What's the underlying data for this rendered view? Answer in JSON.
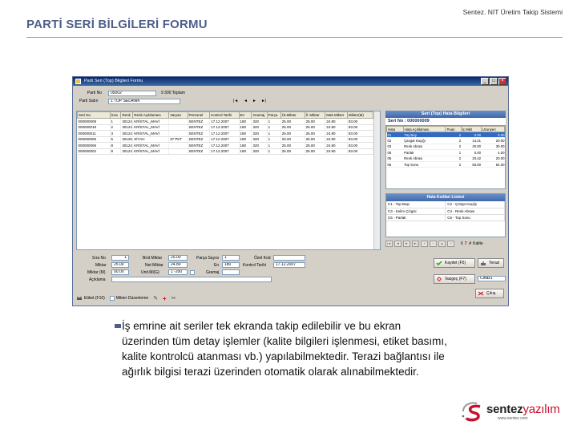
{
  "slide": {
    "title": "PARTİ SERİ BİLGİLERİ FORMU",
    "header_right": "Sentez. NIT Üretim Takip Sistemi",
    "description": "İş emrine ait seriler tek ekranda takip edilebilir ve bu ekran üzerinden tüm detay işlemler (kalite bilgileri işlenmesi, etiket basımı, kalite kontrolcü atanması vb.) yapılabilmektedir. Terazi bağlantısı ile ağırlık bilgisi terazi üzerinden otomatik olarak alınabilmektedir."
  },
  "logo": {
    "brand_a": "sentez",
    "brand_b": "yazılım",
    "url": "www.sentez.com",
    "color_a": "#222222",
    "color_b": "#c8102e"
  },
  "window": {
    "title": "Parti Seri (Top) Bilgileri Formu",
    "minimize": "_",
    "maximize": "□",
    "close": "×"
  },
  "form": {
    "parti_no_label": "Parti No",
    "parti_no_value": "05002",
    "toplam": "9 300 Toplam",
    "parti_sahn_label": "Parti Satırı",
    "parti_sahn_value": "1   TOP SELANİK",
    "nav": [
      "|◄",
      "◄",
      "►",
      "►|"
    ]
  },
  "grid": {
    "columns": [
      "Seri No",
      "Sıra",
      "Renk",
      "Renk Açıklaması",
      "Varyan",
      "Personel",
      "Kontrol Tarihi",
      "En",
      "Gramaj",
      "Parça",
      "Üt.Mikter",
      "İl. Miktar",
      "Mak.Mikter",
      "Mikter(M)"
    ],
    "rows": [
      [
        "000000009",
        "1",
        "301241",
        "KRİSTAL_MAVİ",
        "",
        "SENTEZ",
        "17.12.2007",
        "180",
        "320",
        "1",
        "25.00",
        "25.00",
        "24.80",
        "83.00"
      ],
      [
        "000000018",
        "2",
        "301241",
        "KRİSTAL_MAVİ",
        "",
        "SENTEZ",
        "17.12.2007",
        "180",
        "320",
        "1",
        "25.00",
        "25.00",
        "24.80",
        "83.00"
      ],
      [
        "000000011",
        "3",
        "301241",
        "KRİSTAL_MAVİ",
        "",
        "SENTEZ",
        "17.12.2007",
        "180",
        "320",
        "1",
        "25.00",
        "25.00",
        "24.80",
        "83.00"
      ],
      [
        "000000005",
        "5",
        "301251",
        "SİYAH",
        "37 PKT",
        "SENTEZ",
        "17.12.2007",
        "180",
        "320",
        "1",
        "25.00",
        "25.00",
        "24.80",
        "83.00"
      ],
      [
        "000000006",
        "8",
        "301241",
        "KRİSTAL_MAVİ",
        "",
        "SENTEZ",
        "17.12.2007",
        "180",
        "320",
        "1",
        "25.00",
        "25.00",
        "24.80",
        "83.00"
      ],
      [
        "000000002",
        "9",
        "301241",
        "KRİSTAL_MAVİ",
        "",
        "SENTEZ",
        "17.12.2007",
        "180",
        "320",
        "1",
        "25.00",
        "25.00",
        "24.80",
        "83.00"
      ]
    ]
  },
  "right": {
    "hata_title": "Seri (Top) Hata Bilgileri",
    "seri_no_label": "Seri No :",
    "seri_no_value": "000000009",
    "hata_columns": [
      "Hata",
      "Hata Açıklaması",
      "Puan",
      "İç Mikt",
      "Uzunyeri"
    ],
    "hata_rows": [
      [
        "01",
        "Tüy Boy",
        "2",
        "0.00",
        "0.00"
      ],
      [
        "02",
        "Çavgal Kaçığı",
        "2",
        "14.21",
        "20.00"
      ],
      [
        "03",
        "Renk Abrası",
        "2",
        "20.00",
        "30.00"
      ],
      [
        "05",
        "Parlak",
        "1",
        "0.00",
        "4.00"
      ],
      [
        "05",
        "Renk Abrası",
        "2",
        "20.42",
        "20.00"
      ],
      [
        "06",
        "Top Sonu",
        "2",
        "83.00",
        "84.00"
      ]
    ],
    "hk_title": "Hata Kodları Listesi",
    "hk_rows": [
      [
        "C1 - Top Başı",
        "C2 - Çözgü Kaçığı"
      ],
      [
        "C3 - Kelim Çizgisi",
        "C4 - Renk Abrası"
      ],
      [
        "C5 - Parlak",
        "C6 - Top Sonu"
      ]
    ],
    "nav_count": "6",
    "nav_count2": "7",
    "nav_close": "✗ Kalite"
  },
  "bottom": {
    "sira_no_label": "Sıra No",
    "sira_no_value": "1",
    "miktar_label": "Miktar",
    "miktar_value": "25.00",
    "miktar_m_label": "Miktar (M)",
    "miktar_m_value": "00.00",
    "aciklama_label": "Açıklama",
    "birim_label": "Brüt Miktar",
    "birim_value": "25.00",
    "net_label": "Net Miktar",
    "net_value": "24.80",
    "uzunluk_label": "Unit.Ml(G)",
    "uzunluk_value": "1 -200",
    "parca_label": "Parça Sayısı",
    "parca_value": "1",
    "en_label": "En",
    "en_value": "180",
    "gramaj_label": "Gramaj",
    "ozel_kod_label": "Özel Kod",
    "kontrol_label": "Kontrol Tarihi",
    "kontrol_value": "17.12.2007"
  },
  "actions": {
    "kaydet": "Kaydet (F5)",
    "vazgec": "Vazgeç (F7)",
    "terazi": "Terazi",
    "sec": "Cihaz1",
    "cikis": "Çıkış"
  },
  "statusbar": {
    "etiket": "Etiket (F10)",
    "mikter": "Mikter Düzenleme"
  }
}
